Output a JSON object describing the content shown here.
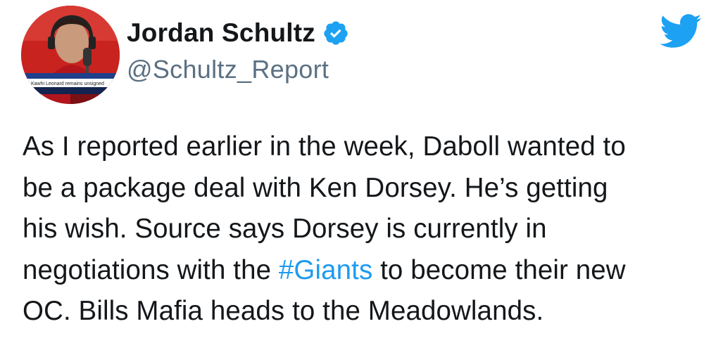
{
  "author": {
    "display_name": "Jordan Schultz",
    "handle": "@Schultz_Report",
    "verified": true,
    "avatar_icon": "profile-photo",
    "avatar_caption": "Kawhi Leonard remains unsigned"
  },
  "brand": {
    "icon": "twitter-bird-icon",
    "color": "#1da1f2"
  },
  "tweet": {
    "lines": [
      {
        "text": "As I reported earlier in the week, Daboll wanted to"
      },
      {
        "text": "be a package deal with Ken Dorsey. He’s getting"
      },
      {
        "text": "his wish. Source says Dorsey is currently in"
      },
      {
        "before": "negotiations with the ",
        "hashtag": "#Giants",
        "after": " to become their new"
      },
      {
        "text": "OC. Bills Mafia heads to the Meadowlands."
      }
    ],
    "hashtag_color": "#1d9bf0"
  }
}
